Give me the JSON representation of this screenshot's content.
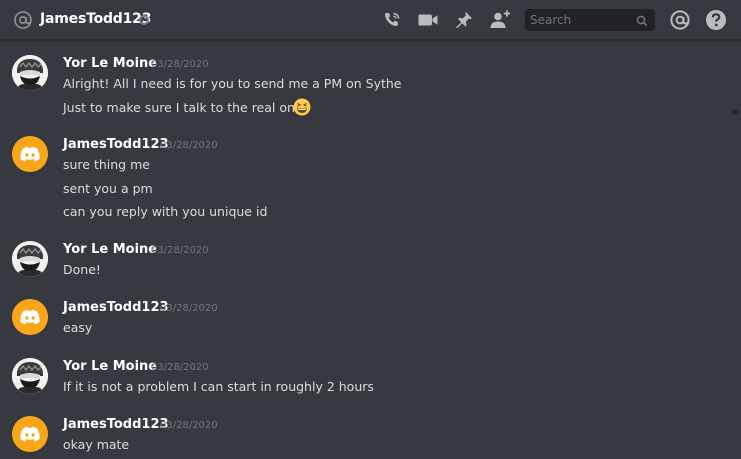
{
  "header": {
    "title": "JamesTodd123",
    "search_placeholder": "Search",
    "icons": [
      "at-icon",
      "status-dot",
      "call-icon",
      "video-icon",
      "pin-icon",
      "add-friend-icon",
      "search-icon",
      "mentions-icon",
      "help-icon"
    ]
  },
  "messages": [
    {
      "author": "Yor Le Moine",
      "avatar": "yor-avatar",
      "timestamp": "03/28/2020",
      "lines": [
        "Alright! All I need is for you to send me a PM on Sythe",
        "Just to make sure I talk to the real one"
      ],
      "emoji": "grinning-squinting-emoji"
    },
    {
      "author": "JamesTodd123",
      "avatar": "discord-avatar",
      "timestamp": "03/28/2020",
      "lines": [
        "sure thing me",
        "sent you a pm",
        "can you reply with you unique id"
      ]
    },
    {
      "author": "Yor Le Moine",
      "avatar": "yor-avatar",
      "timestamp": "03/28/2020",
      "lines": [
        "Done!"
      ]
    },
    {
      "author": "JamesTodd123",
      "avatar": "discord-avatar",
      "timestamp": "03/28/2020",
      "lines": [
        "easy"
      ]
    },
    {
      "author": "Yor Le Moine",
      "avatar": "yor-avatar",
      "timestamp": "03/28/2020",
      "lines": [
        "If it is not a problem I can start in roughly 2 hours"
      ]
    },
    {
      "author": "JamesTodd123",
      "avatar": "discord-avatar",
      "timestamp": "03/28/2020",
      "lines": [
        "okay mate"
      ]
    }
  ],
  "colors": {
    "background": "#36393f",
    "text": "#dcddde",
    "muted": "#72767d",
    "discord_avatar": "#faa61a"
  }
}
